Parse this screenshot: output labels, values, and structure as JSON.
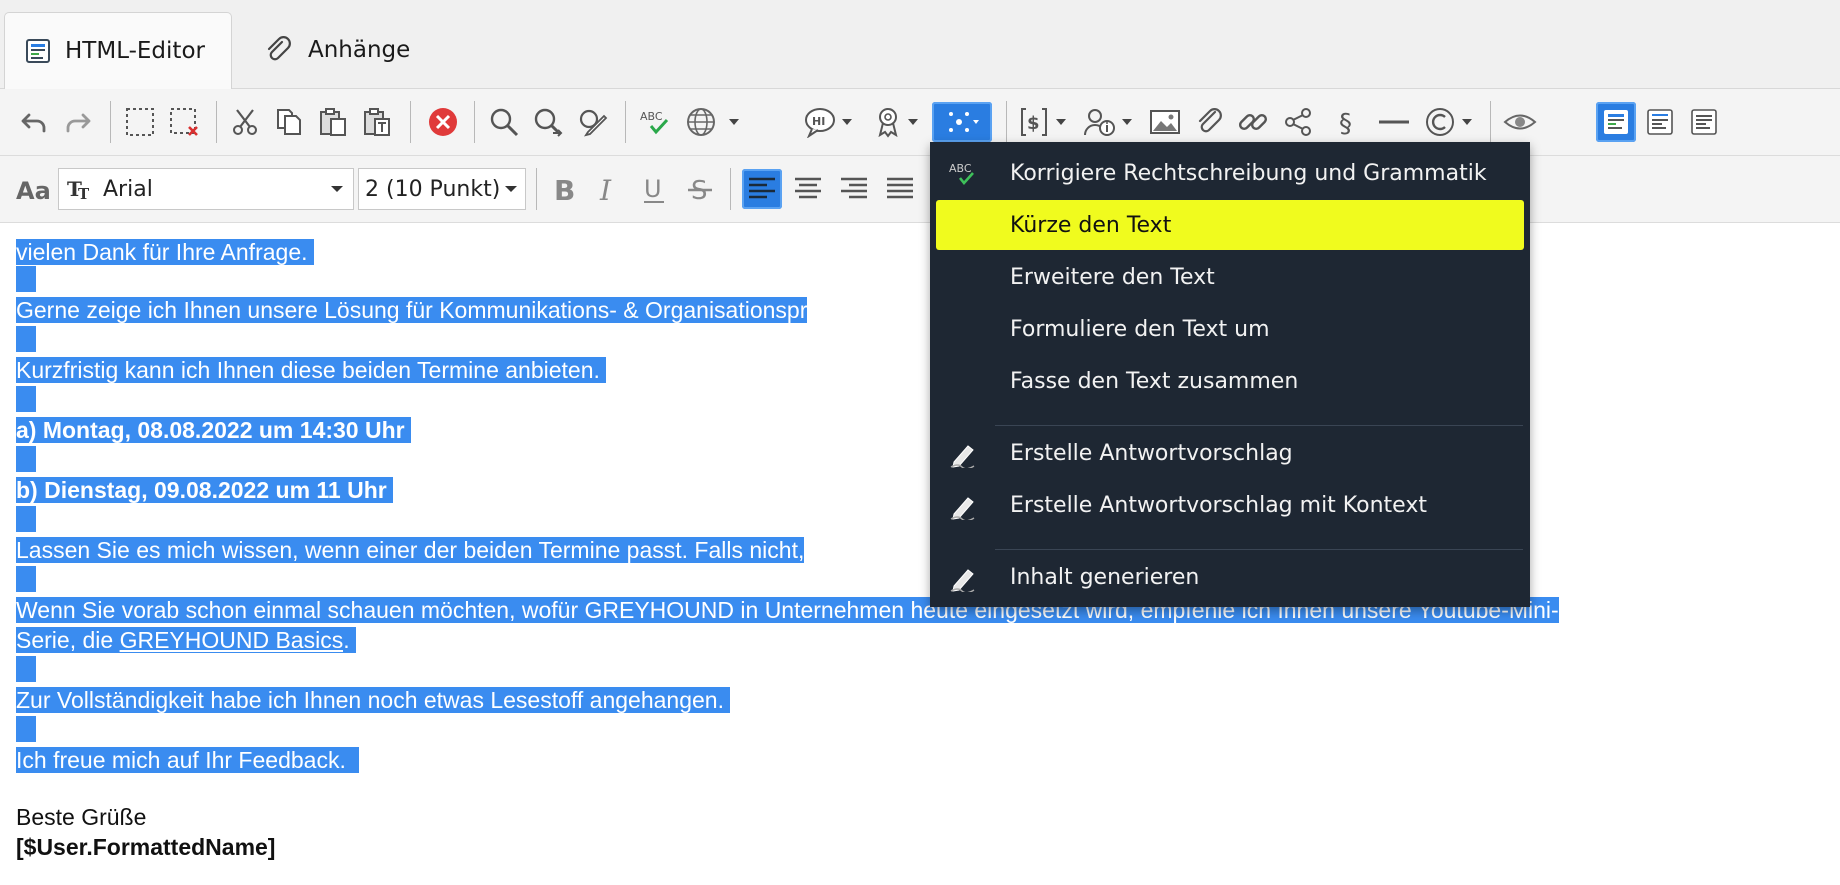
{
  "tabs": [
    {
      "label": "HTML-Editor",
      "icon": "html-editor-icon",
      "active": true
    },
    {
      "label": "Anhänge",
      "icon": "paperclip-icon",
      "active": false
    }
  ],
  "toolbar": {
    "font_family": "Arial",
    "font_size": "2 (10 Punkt)",
    "accent_color": "#2a7de1"
  },
  "menu": {
    "items": [
      {
        "label": "Korrigiere Rechtschreibung und Grammatik",
        "icon": "spellcheck-icon"
      },
      {
        "label": "Kürze den Text",
        "highlighted": true
      },
      {
        "label": "Erweitere den Text"
      },
      {
        "label": "Formuliere den Text um"
      },
      {
        "label": "Fasse den Text zusammen"
      },
      {
        "label": "Erstelle Antwortvorschlag",
        "icon": "pen-icon"
      },
      {
        "label": "Erstelle Antwortvorschlag mit Kontext",
        "icon": "pen-icon"
      },
      {
        "label": "Inhalt generieren",
        "icon": "pen-icon"
      }
    ],
    "highlight_color": "#f0fb1e",
    "background_color": "#1e2733"
  },
  "editor": {
    "selection_color": "#3a8cf0",
    "lines": {
      "l1": "vielen Dank für Ihre Anfrage.",
      "l2": "Gerne zeige ich Ihnen unsere Lösung für Kommunikations- & Organisationspr",
      "l3": "Kurzfristig kann ich Ihnen diese beiden Termine anbieten.",
      "l4": "a) Montag, 08.08.2022 um 14:30 Uhr",
      "l5": "b) Dienstag, 09.08.2022 um 11 Uhr",
      "l6": "Lassen Sie es mich wissen, wenn einer der beiden Termine passt. Falls nicht,",
      "l7": "Wenn Sie vorab schon einmal schauen möchten, wofür GREYHOUND in Unternehmen heute eingesetzt wird, empfehle ich Ihnen unsere Youtube-Mini-",
      "l8a": "Serie, die ",
      "l8link": "GREYHOUND Basics",
      "l8b": ".",
      "l9": "Zur Vollständigkeit habe ich Ihnen noch etwas Lesestoff angehangen.",
      "l10": "Ich freue mich auf Ihr Feedback.",
      "l11": "Beste Grüße",
      "l12": "[$User.FormattedName]"
    }
  }
}
